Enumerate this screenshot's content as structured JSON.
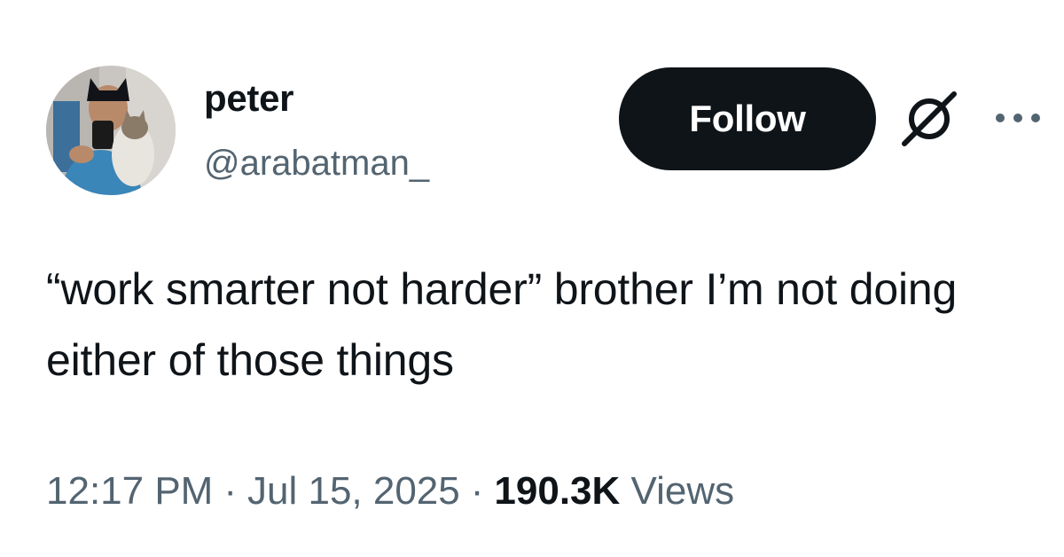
{
  "user": {
    "display_name": "peter",
    "handle": "@arabatman_",
    "avatar_icon": "profile-photo"
  },
  "actions": {
    "follow_label": "Follow",
    "grok_icon": "grok-icon",
    "more_icon": "more-options-icon"
  },
  "tweet": {
    "text": "“work smarter not harder” brother I’m not doing either of those things"
  },
  "meta": {
    "time": "12:17 PM",
    "separator": "·",
    "date": "Jul 15, 2025",
    "views_count": "190.3K",
    "views_label": "Views"
  },
  "colors": {
    "text_primary": "#0f1419",
    "text_secondary": "#536471",
    "button_bg": "#0f1419",
    "button_text": "#ffffff",
    "background": "#ffffff"
  }
}
